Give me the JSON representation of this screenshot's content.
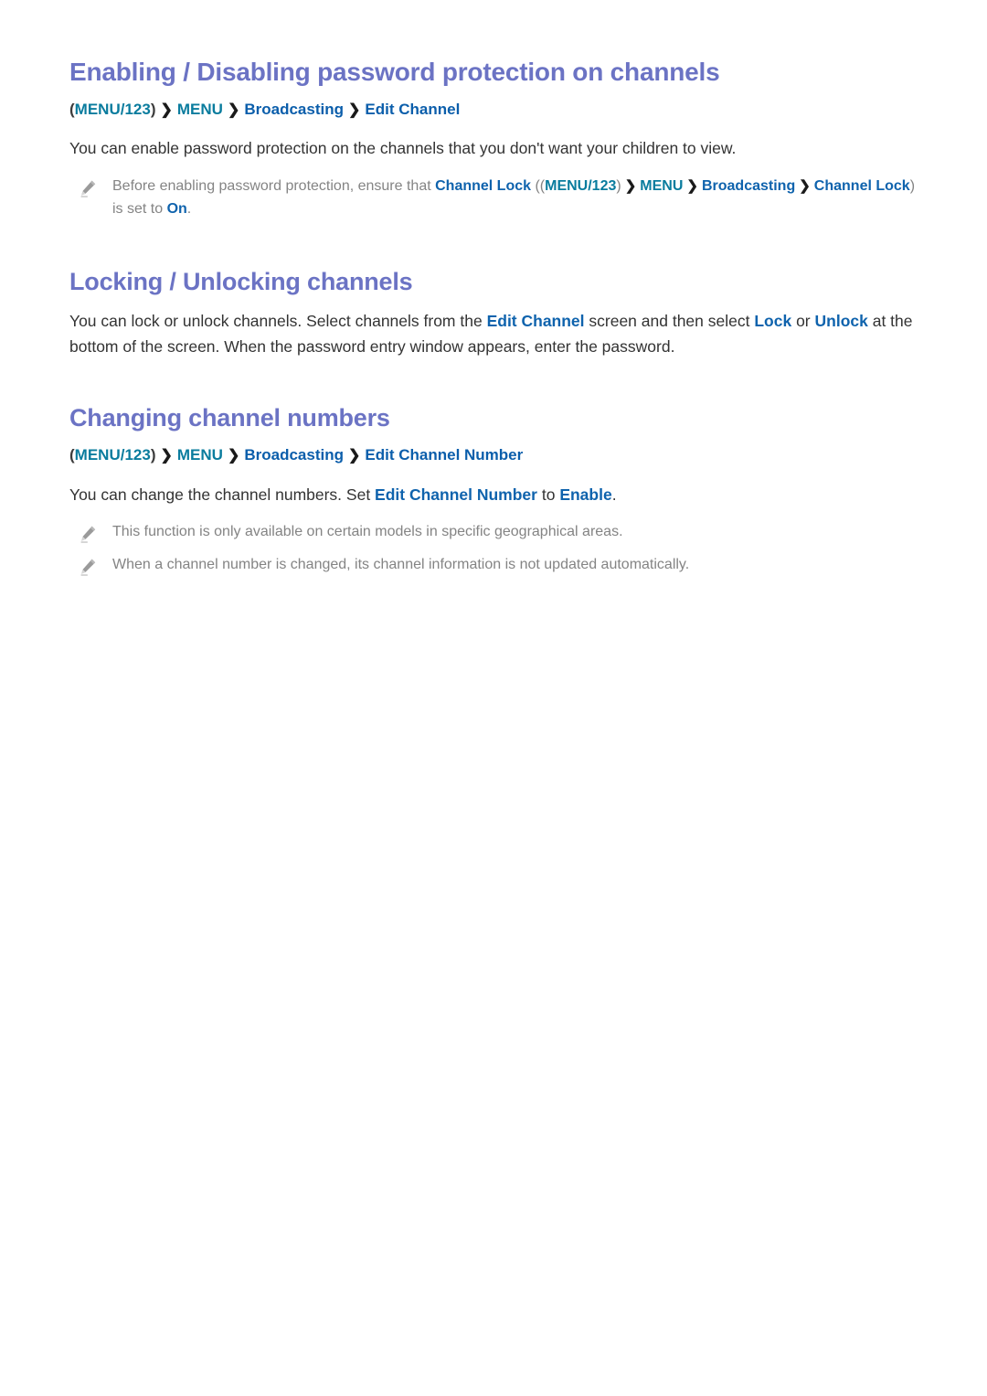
{
  "document": {
    "background_color": "#ffffff",
    "heading_color": "#6b73c4",
    "body_color": "#333333",
    "note_color": "#848484",
    "link_color": "#0f63ad",
    "teal_color": "#0a7c9e",
    "breadcrumb_blue": "#0b5eab"
  },
  "sections": [
    {
      "heading": "Enabling / Disabling password protection on channels",
      "breadcrumb": {
        "open_paren": "(",
        "menu123": "MENU/123",
        "close_paren": ")",
        "separator": "❯",
        "items": [
          "MENU",
          "Broadcasting",
          "Edit Channel"
        ]
      },
      "paragraph": {
        "text": "You can enable password protection on the channels that you don't want your children to view."
      },
      "note": {
        "icon": "pencil-icon",
        "part1": "Before enabling password protection, ensure that ",
        "link1": "Channel Lock",
        "part2": " ((",
        "menu123": "MENU/123",
        "part3": ")",
        "sep": "❯",
        "menu": "MENU",
        "broadcasting": "Broadcasting",
        "link2": "Channel Lock",
        "part4": ") is set to ",
        "link3": "On",
        "part5": "."
      }
    },
    {
      "heading": "Locking / Unlocking channels",
      "paragraph": {
        "p1": "You can lock or unlock channels. Select channels from the ",
        "link1": "Edit Channel",
        "p2": " screen and then select ",
        "link2": "Lock",
        "p3": " or ",
        "link3": "Unlock",
        "p4": " at the bottom of the screen. When the password entry window appears, enter the password."
      }
    },
    {
      "heading": "Changing channel numbers",
      "breadcrumb": {
        "open_paren": "(",
        "menu123": "MENU/123",
        "close_paren": ")",
        "separator": "❯",
        "items": [
          "MENU",
          "Broadcasting",
          "Edit Channel Number"
        ]
      },
      "paragraph": {
        "p1": "You can change the channel numbers. Set ",
        "link1": "Edit Channel Number",
        "p2": " to ",
        "link2": "Enable",
        "p3": "."
      },
      "notes": [
        {
          "icon": "pencil-icon",
          "text": "This function is only available on certain models in specific geographical areas."
        },
        {
          "icon": "pencil-icon",
          "text": "When a channel number is changed, its channel information is not updated automatically."
        }
      ]
    }
  ]
}
